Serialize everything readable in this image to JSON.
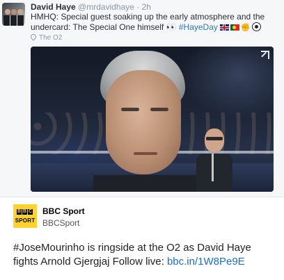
{
  "tweet": {
    "author_name": "David Haye",
    "author_handle": "@mrdavidhaye",
    "separator": "·",
    "time": "2h",
    "text_main": "HMHQ: Special guest soaking up the early atmosphere and the undercard: The Special One himself",
    "text_eyes": "👀",
    "hashtag": "#HayeDay",
    "emojis": [
      "uk-flag-icon",
      "portugal-flag-icon",
      "flexed-arm-icon",
      "football-icon"
    ],
    "location": "The O2"
  },
  "photo": {
    "subject": "photo"
  },
  "post": {
    "source_name": "BBC Sport",
    "source_handle": "BBCSport",
    "logo": {
      "letters": [
        "B",
        "B",
        "C"
      ],
      "word": "SPORT"
    },
    "text": "#JoseMourinho is ringside at the O2 as David Haye fights Arnold Gjergjaj Follow live: ",
    "link": "bbc.in/1W8Pe9E"
  },
  "colors": {
    "tweet_background": "#f6f7f8",
    "hashtag": "#2b7bb9",
    "bbc_yellow": "#ffd230",
    "link": "#1a6fc4"
  }
}
